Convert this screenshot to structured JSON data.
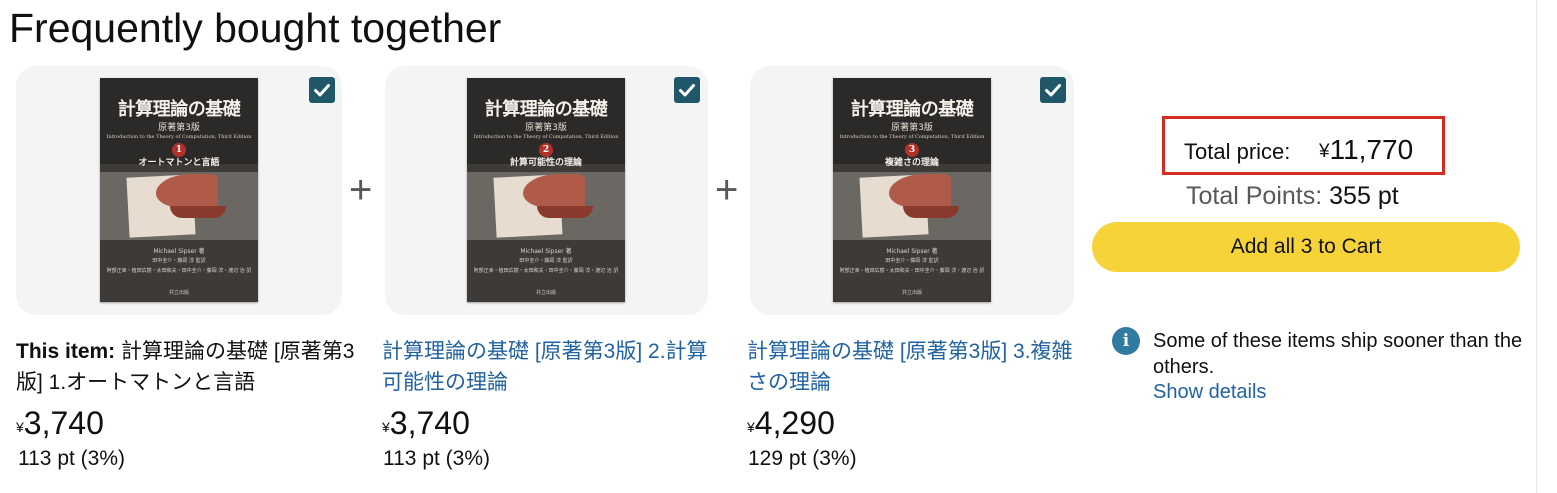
{
  "heading": "Frequently bought together",
  "items": [
    {
      "checked": true,
      "cover": {
        "title": "計算理論の基礎",
        "edition": "原著第3版",
        "english": "Introduction to the Theory of Computation, Third Edition",
        "volume": "1",
        "subtitle": "オートマトンと言語",
        "author": "Michael Sipser 著",
        "translators": "田中圭介・藤岡 淳 監訳",
        "translators2": "阿部正幸・植田広樹・太田和夫・田中圭介・藤岡 淳・渡辺 治 訳",
        "publisher": "共立出版"
      },
      "this_item_label": "This item:",
      "title": "計算理論の基礎 [原著第3版] 1.オートマトンと言語",
      "currency": "¥",
      "price": "3,740",
      "points": "113 pt (3%)"
    },
    {
      "checked": true,
      "cover": {
        "title": "計算理論の基礎",
        "edition": "原著第3版",
        "english": "Introduction to the Theory of Computation, Third Edition",
        "volume": "2",
        "subtitle": "計算可能性の理論",
        "author": "Michael Sipser 著",
        "translators": "田中圭介・藤岡 淳 監訳",
        "translators2": "阿部正幸・植田広樹・太田和夫・田中圭介・藤岡 淳・渡辺 治 訳",
        "publisher": "共立出版"
      },
      "title": "計算理論の基礎 [原著第3版] 2.計算可能性の理論",
      "currency": "¥",
      "price": "3,740",
      "points": "113 pt (3%)"
    },
    {
      "checked": true,
      "cover": {
        "title": "計算理論の基礎",
        "edition": "原著第3版",
        "english": "Introduction to the Theory of Computation, Third Edition",
        "volume": "3",
        "subtitle": "複雑さの理論",
        "author": "Michael Sipser 著",
        "translators": "田中圭介・藤岡 淳 監訳",
        "translators2": "阿部正幸・植田広樹・太田和夫・田中圭介・藤岡 淳・渡辺 治 訳",
        "publisher": "共立出版"
      },
      "title": "計算理論の基礎 [原著第3版] 3.複雑さの理論",
      "currency": "¥",
      "price": "4,290",
      "points": "129 pt (3%)"
    }
  ],
  "plus_sign": "+",
  "summary": {
    "total_price_label": "Total price:",
    "total_currency": "¥",
    "total_price": "11,770",
    "total_points_label": "Total Points:",
    "total_points_value": "355",
    "total_points_unit": "pt",
    "add_to_cart_label": "Add all 3 to Cart",
    "ship_note": "Some of these items ship sooner than the others.",
    "show_details": "Show details",
    "info_glyph": "i"
  },
  "colors": {
    "link": "#2162a1",
    "checkbox": "#205769",
    "cart_button": "#f7d33a",
    "highlight_border": "#d42c22",
    "info_icon": "#2f7ba1"
  }
}
